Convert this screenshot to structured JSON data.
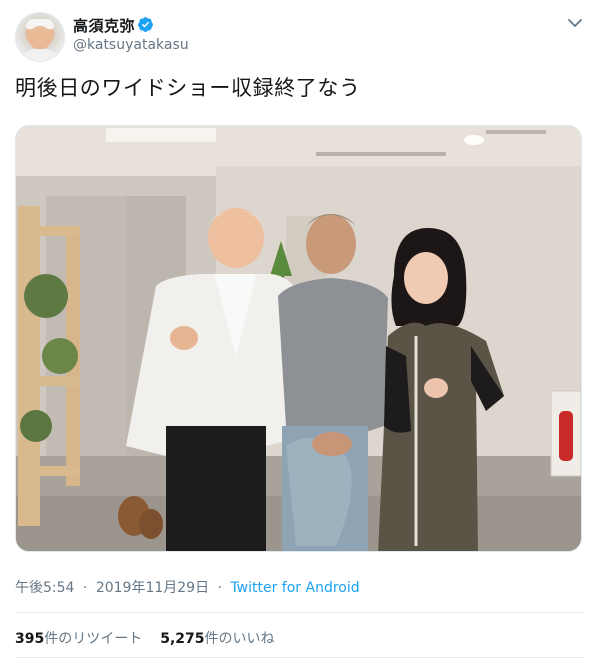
{
  "user": {
    "display_name": "高須克弥",
    "handle": "@katsuyatakasu",
    "verified": true
  },
  "tweet": {
    "text": "明後日のワイドショー収録終了なう",
    "media_alt": "photo"
  },
  "meta": {
    "time": "午後5:54",
    "separator": "·",
    "date": "2019年11月29日",
    "source": "Twitter for Android"
  },
  "stats": {
    "retweets_count": "395",
    "retweets_label": "件のリツイート",
    "likes_count": "5,275",
    "likes_label": "件のいいね"
  },
  "colors": {
    "accent": "#1da1f2",
    "text": "#14171a",
    "secondary": "#657786"
  },
  "icons": {
    "verified": "verified-badge-icon",
    "menu": "chevron-down-icon"
  }
}
